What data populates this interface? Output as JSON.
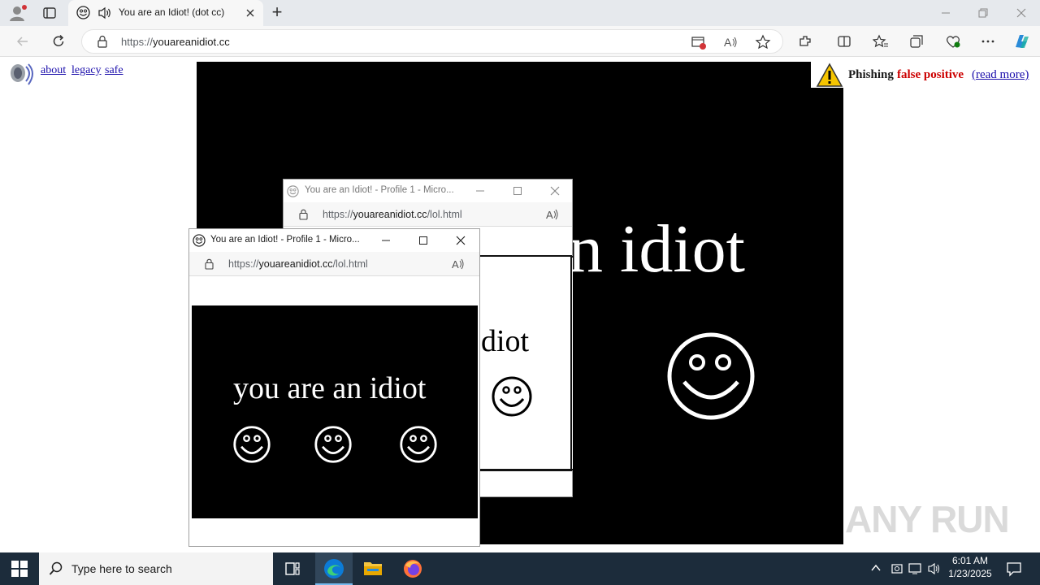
{
  "browser": {
    "tab_title": "You are an Idiot! (dot cc)",
    "url_scheme": "https://",
    "url_host": "youareanidiot.cc",
    "new_tab_label": "+"
  },
  "page": {
    "links": [
      "about",
      "legacy",
      "safe"
    ],
    "main_text": "n idiot",
    "phishing": {
      "word1": "Phishing",
      "word2": "false positive",
      "link": "(read more)",
      "accent": "#cc0000"
    }
  },
  "popups": [
    {
      "title": "You are an Idiot! - Profile 1 - Micro...",
      "url_scheme": "https://",
      "url_host": "youareanidiot.cc",
      "url_path": "/lol.html",
      "content_text": "diot"
    },
    {
      "title": "You are an Idiot! - Profile 1 - Micro...",
      "url_scheme": "https://",
      "url_host": "youareanidiot.cc",
      "url_path": "/lol.html",
      "content_text": "you are an idiot"
    }
  ],
  "taskbar": {
    "search_placeholder": "Type here to search",
    "time": "6:01 AM",
    "date": "1/23/2025"
  },
  "watermark": "ANY RUN"
}
